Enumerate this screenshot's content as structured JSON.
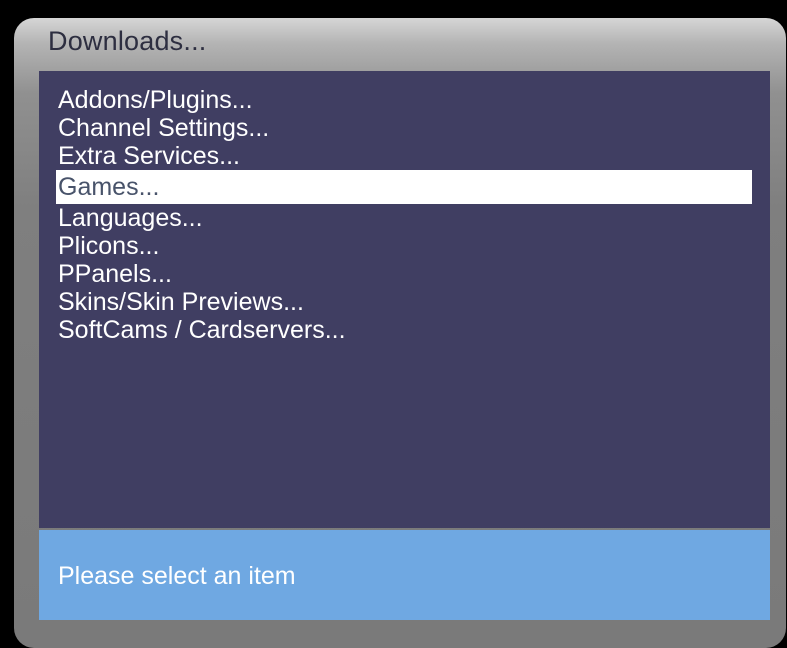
{
  "window": {
    "title": "Downloads..."
  },
  "menu": {
    "selected_index": 3,
    "items": [
      {
        "label": "Addons/Plugins..."
      },
      {
        "label": "Channel Settings..."
      },
      {
        "label": "Extra Services..."
      },
      {
        "label": "Games..."
      },
      {
        "label": "Languages..."
      },
      {
        "label": "Plicons..."
      },
      {
        "label": "PPanels..."
      },
      {
        "label": "Skins/Skin Previews..."
      },
      {
        "label": "SoftCams / Cardservers..."
      }
    ]
  },
  "status": {
    "text": "Please select an item"
  },
  "colors": {
    "list_background": "#403e62",
    "selection_background": "#ffffff",
    "selection_text": "#48536a",
    "status_background": "#6fa8e2",
    "title_text": "#2d2e40"
  }
}
